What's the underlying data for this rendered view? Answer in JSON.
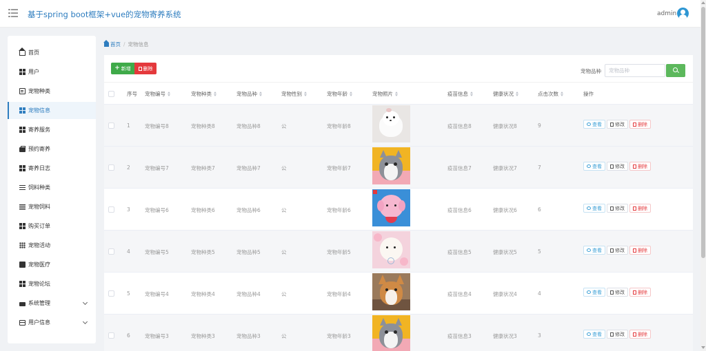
{
  "header": {
    "app_title": "基于spring boot框架+vue的宠物寄养系统",
    "username": "admin"
  },
  "sidebar": {
    "items": [
      {
        "label": "首页",
        "icon": "home-icon"
      },
      {
        "label": "用户",
        "icon": "grid-icon"
      },
      {
        "label": "宠物种类",
        "icon": "clipboard-icon"
      },
      {
        "label": "宠物信息",
        "icon": "grid-icon",
        "active": true
      },
      {
        "label": "寄养服务",
        "icon": "grid-icon"
      },
      {
        "label": "预约寄养",
        "icon": "briefcase-icon"
      },
      {
        "label": "寄养日志",
        "icon": "grid-icon"
      },
      {
        "label": "饲料种类",
        "icon": "sliders-icon"
      },
      {
        "label": "宠物饲料",
        "icon": "list-icon"
      },
      {
        "label": "购买订单",
        "icon": "grid-icon"
      },
      {
        "label": "宠物活动",
        "icon": "grid9-icon"
      },
      {
        "label": "宠物医疗",
        "icon": "chart-icon"
      },
      {
        "label": "宠物论坛",
        "icon": "grid-icon"
      },
      {
        "label": "系统管理",
        "icon": "truck-icon",
        "expandable": true
      },
      {
        "label": "用户信息",
        "icon": "card-icon",
        "expandable": true
      }
    ]
  },
  "breadcrumb": {
    "home": "首页",
    "separator": "/",
    "current": "宠物信息"
  },
  "toolbar": {
    "add_label": "新增",
    "delete_label": "删除",
    "search_label": "宠物品种",
    "search_placeholder": "宠物品种"
  },
  "table": {
    "headers": [
      "序号",
      "宠物编号",
      "宠物种类",
      "宠物品种",
      "宠物性别",
      "宠物年龄",
      "宠物照片",
      "疫苗信息",
      "健康状况",
      "点击次数",
      "操作"
    ],
    "actions": {
      "view": "查看",
      "edit": "修改",
      "delete": "删除"
    },
    "rows": [
      {
        "index": "1",
        "pet_no": "宠物编号8",
        "pet_type": "宠物种类8",
        "breed": "宠物品种8",
        "gender": "公",
        "age": "宠物年龄8",
        "vaccine": "疫苗信息8",
        "health": "健康状况8",
        "clicks": "9",
        "photo": "white-dog"
      },
      {
        "index": "2",
        "pet_no": "宠物编号7",
        "pet_type": "宠物种类7",
        "breed": "宠物品种7",
        "gender": "公",
        "age": "宠物年龄7",
        "vaccine": "疫苗信息7",
        "health": "健康状况7",
        "clicks": "7",
        "photo": "grey-cat-yellow"
      },
      {
        "index": "3",
        "pet_no": "宠物编号6",
        "pet_type": "宠物种类6",
        "breed": "宠物品种6",
        "gender": "公",
        "age": "宠物年龄6",
        "vaccine": "疫苗信息6",
        "health": "健康状况6",
        "clicks": "6",
        "photo": "pink-dog-blue"
      },
      {
        "index": "4",
        "pet_no": "宠物编号5",
        "pet_type": "宠物种类5",
        "breed": "宠物品种5",
        "gender": "公",
        "age": "宠物年龄5",
        "vaccine": "疫苗信息5",
        "health": "健康状况5",
        "clicks": "5",
        "photo": "white-dog-pink"
      },
      {
        "index": "5",
        "pet_no": "宠物编号4",
        "pet_type": "宠物种类4",
        "breed": "宠物品种4",
        "gender": "公",
        "age": "宠物年龄4",
        "vaccine": "疫苗信息4",
        "health": "健康状况4",
        "clicks": "4",
        "photo": "corgi"
      },
      {
        "index": "6",
        "pet_no": "宠物编号3",
        "pet_type": "宠物种类3",
        "breed": "宠物品种3",
        "gender": "公",
        "age": "宠物年龄3",
        "vaccine": "疫苗信息3",
        "health": "健康状况3",
        "clicks": "3",
        "photo": "grey-cat-yellow"
      }
    ]
  },
  "colors": {
    "accent": "#2e7dbf",
    "add_button": "#3faa49",
    "delete_button": "#e4393c",
    "search_button": "#5cb85c"
  }
}
